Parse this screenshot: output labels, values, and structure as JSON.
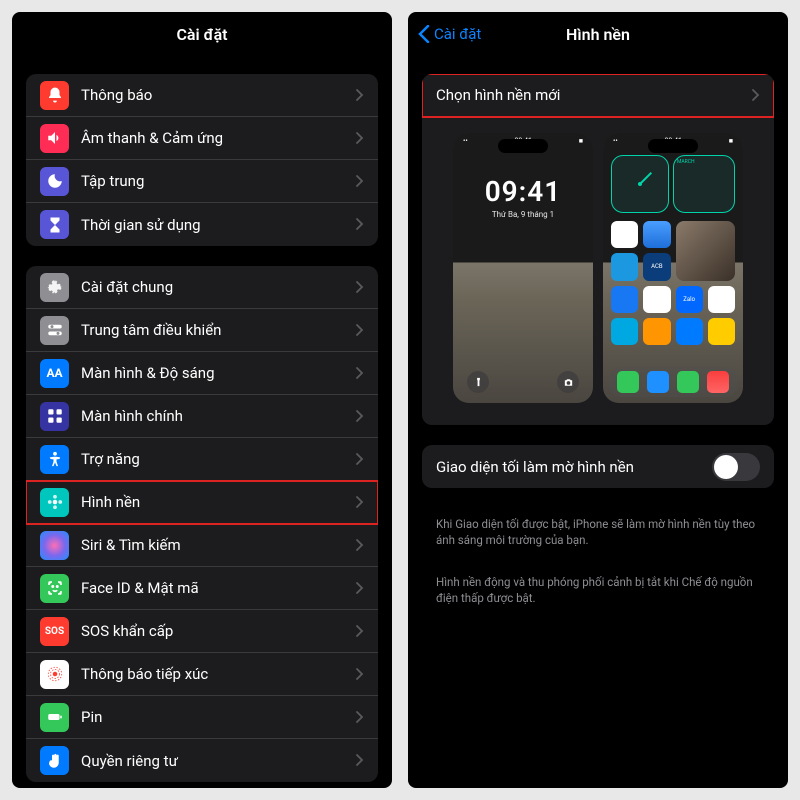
{
  "left": {
    "title": "Cài đặt",
    "group1": [
      {
        "label": "Thông báo",
        "color": "#ff3b30",
        "icon": "bell"
      },
      {
        "label": "Âm thanh & Cảm ứng",
        "color": "#ff2d55",
        "icon": "speaker"
      },
      {
        "label": "Tập trung",
        "color": "#5856d6",
        "icon": "moon"
      },
      {
        "label": "Thời gian sử dụng",
        "color": "#5856d6",
        "icon": "hourglass"
      }
    ],
    "group2": [
      {
        "label": "Cài đặt chung",
        "color": "#8e8e93",
        "icon": "gear"
      },
      {
        "label": "Trung tâm điều khiển",
        "color": "#8e8e93",
        "icon": "switches"
      },
      {
        "label": "Màn hình & Độ sáng",
        "color": "#007aff",
        "icon": "aa"
      },
      {
        "label": "Màn hình chính",
        "color": "#3634a3",
        "icon": "grid"
      },
      {
        "label": "Trợ năng",
        "color": "#007aff",
        "icon": "person"
      },
      {
        "label": "Hình nền",
        "color": "#00c7be",
        "icon": "flower",
        "highlight": true
      },
      {
        "label": "Siri & Tìm kiếm",
        "color": "linear-gradient(135deg,#4a4a4a,#1a1a1a)",
        "icon": "siri"
      },
      {
        "label": "Face ID & Mật mã",
        "color": "#34c759",
        "icon": "faceid"
      },
      {
        "label": "SOS khẩn cấp",
        "color": "#ff3b30",
        "icon": "sos"
      },
      {
        "label": "Thông báo tiếp xúc",
        "color": "#ff3b30",
        "icon": "exposure"
      },
      {
        "label": "Pin",
        "color": "#34c759",
        "icon": "battery"
      },
      {
        "label": "Quyền riêng tư",
        "color": "#007aff",
        "icon": "hand"
      }
    ]
  },
  "right": {
    "back": "Cài đặt",
    "title": "Hình nền",
    "choose": "Chọn hình nền mới",
    "dim_label": "Giao diện tối làm mờ hình nền",
    "desc1": "Khi Giao diện tối được bật, iPhone sẽ làm mờ hình nền tùy theo ánh sáng môi trường của bạn.",
    "desc2": "Hình nền động và thu phóng phối cảnh bị tắt khi Chế độ nguồn điện thấp được bật.",
    "preview_time": "09:41",
    "preview_date": "Thứ Ba, 9 tháng 1"
  }
}
